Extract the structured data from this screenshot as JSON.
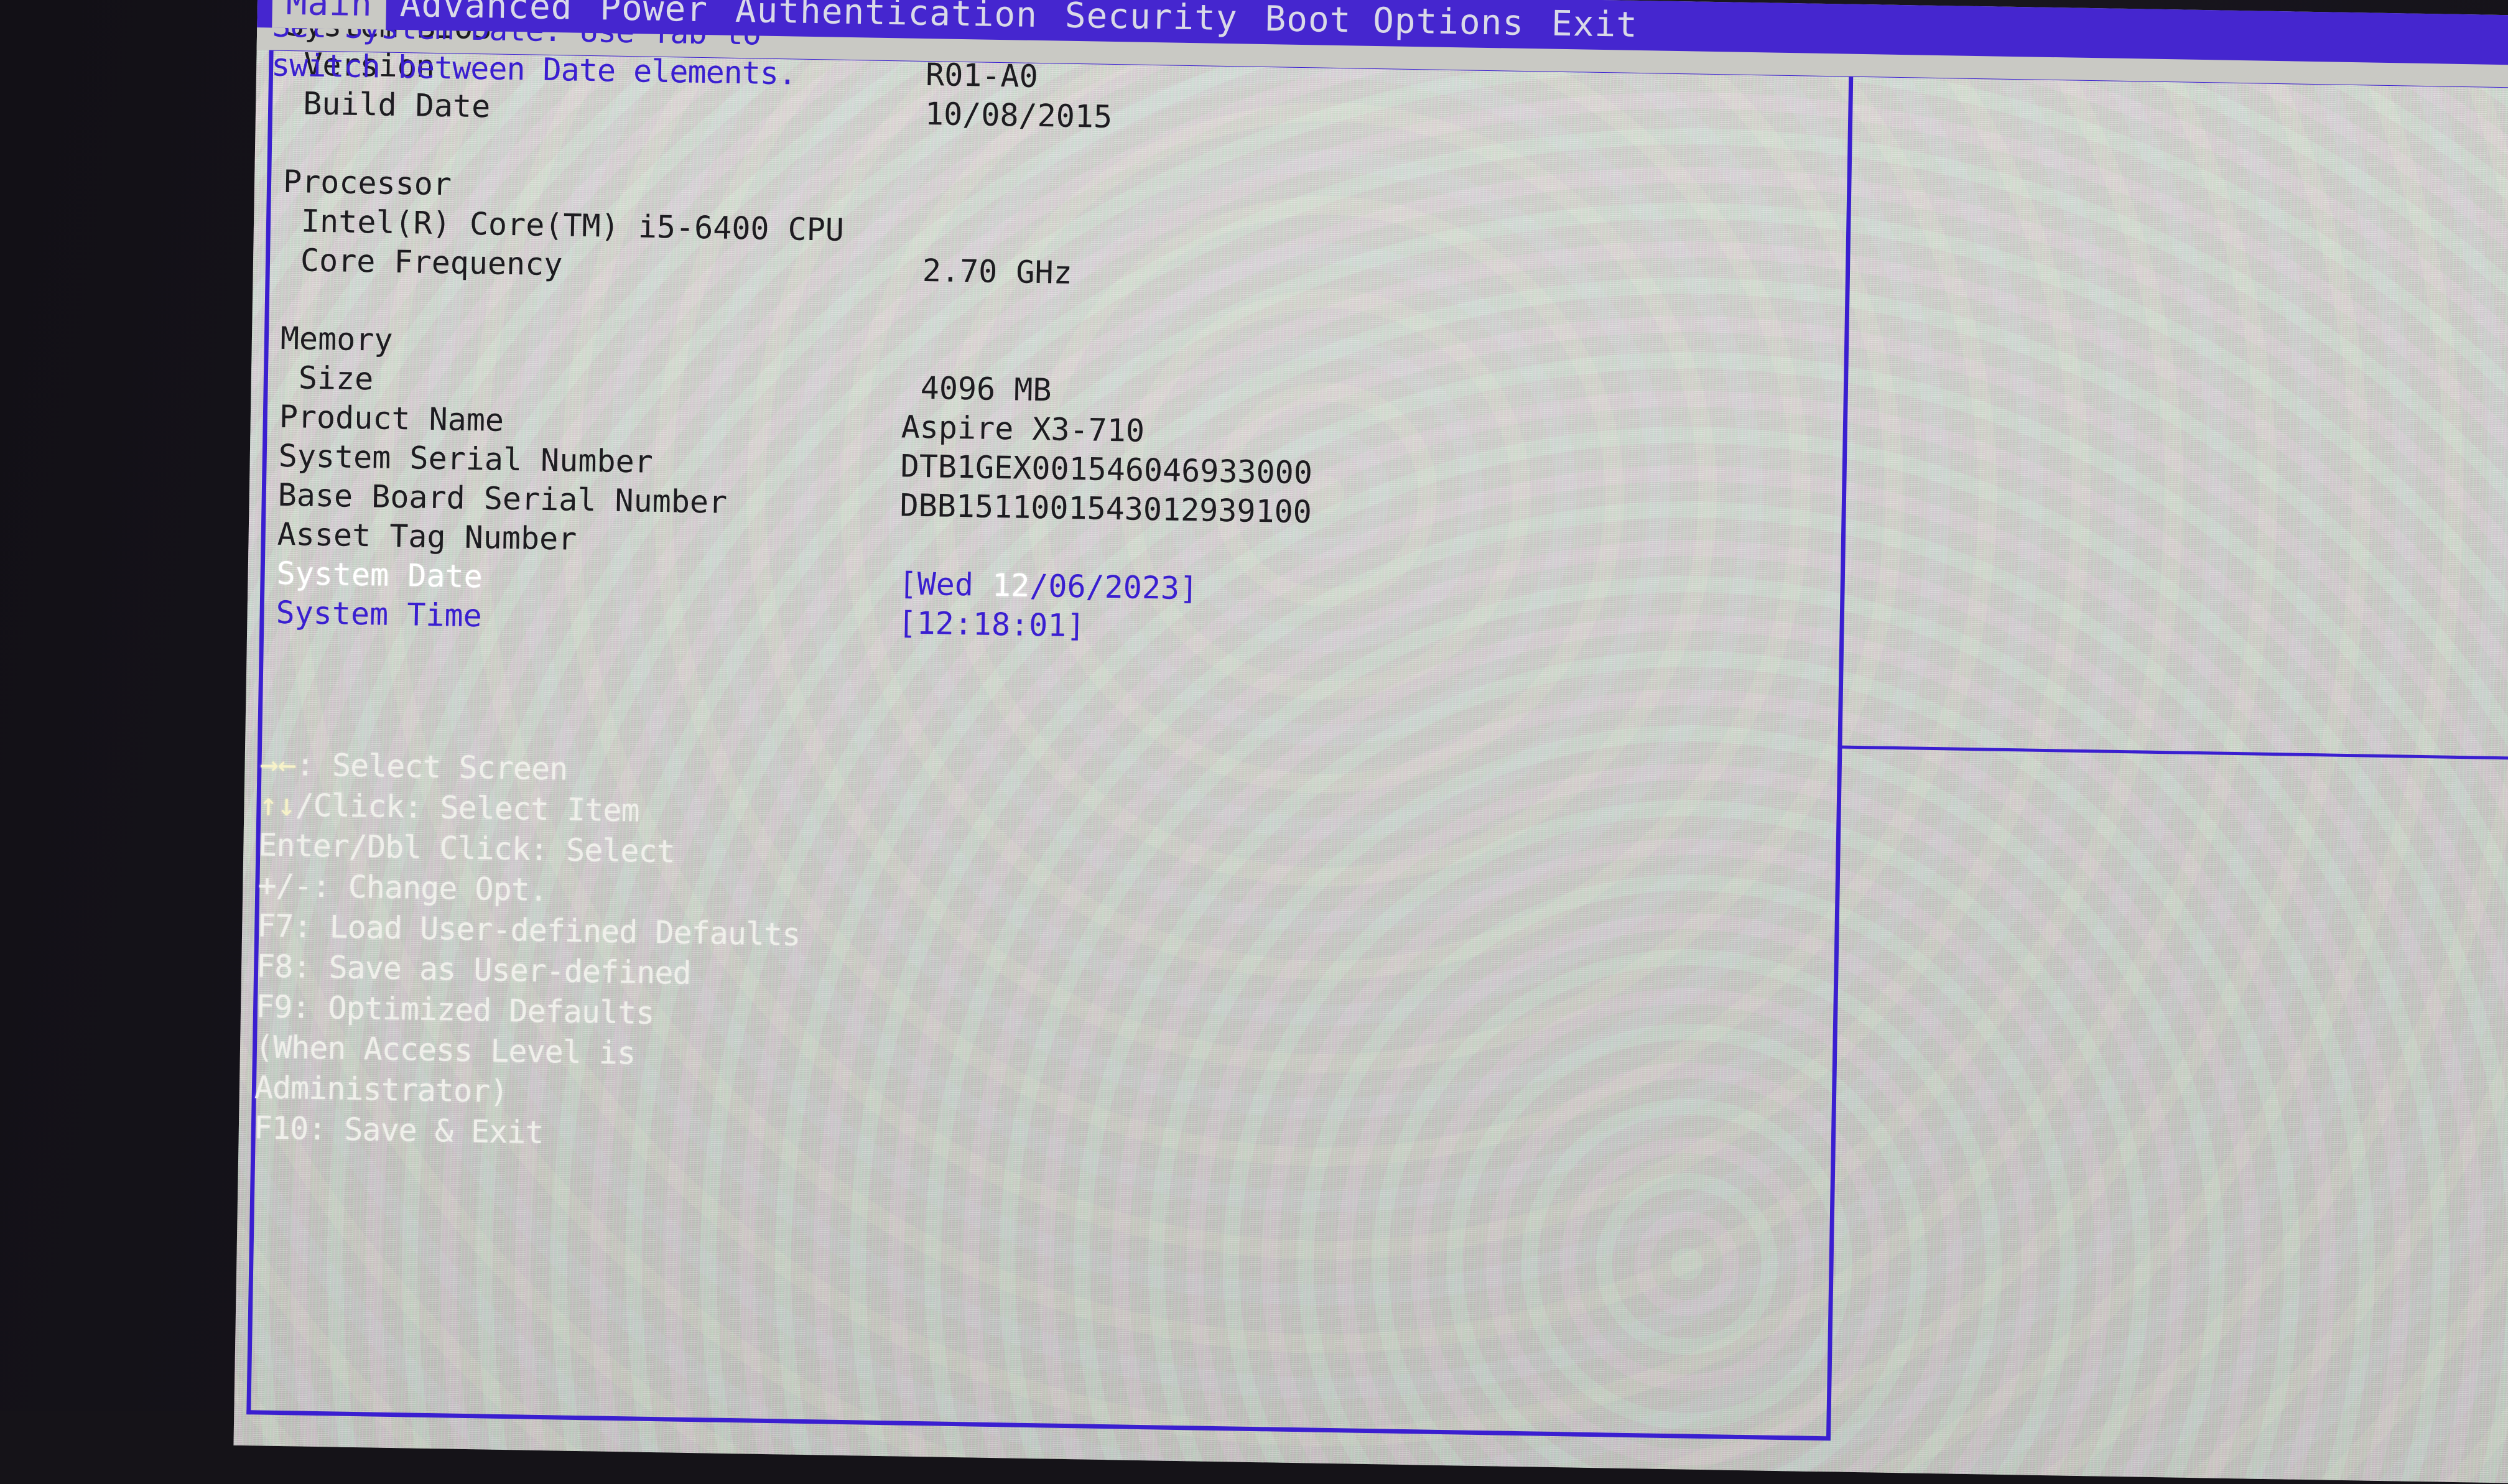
{
  "menubar": {
    "tabs": [
      {
        "label": "Main",
        "active": true
      },
      {
        "label": "Advanced",
        "active": false
      },
      {
        "label": "Power",
        "active": false
      },
      {
        "label": "Authentication",
        "active": false
      },
      {
        "label": "Security",
        "active": false
      },
      {
        "label": "Boot Options",
        "active": false
      },
      {
        "label": "Exit",
        "active": false
      }
    ]
  },
  "main": {
    "rows": [
      {
        "label": "System BIOS",
        "value": "",
        "indent": false,
        "state": "normal"
      },
      {
        "label": "Version",
        "value": "R01-A0",
        "indent": true,
        "state": "normal"
      },
      {
        "label": "Build Date",
        "value": "10/08/2015",
        "indent": true,
        "state": "normal"
      },
      {
        "label": "Processor",
        "value": "",
        "indent": false,
        "state": "normal"
      },
      {
        "label": "Intel(R) Core(TM) i5-6400 CPU",
        "value": "",
        "indent": true,
        "state": "normal"
      },
      {
        "label": "Core Frequency",
        "value": "2.70 GHz",
        "indent": true,
        "state": "normal"
      },
      {
        "label": "Memory",
        "value": "",
        "indent": false,
        "state": "normal"
      },
      {
        "label": "Size",
        "value": "4096 MB",
        "indent": true,
        "state": "normal"
      },
      {
        "label": "Product Name",
        "value": "Aspire X3-710",
        "indent": false,
        "state": "normal"
      },
      {
        "label": "System Serial Number",
        "value": "DTB1GEX001546046933000",
        "indent": false,
        "state": "normal"
      },
      {
        "label": "Base Board Serial Number",
        "value": "DBB1511001543012939100",
        "indent": false,
        "state": "normal"
      },
      {
        "label": "Asset Tag Number",
        "value": "",
        "indent": false,
        "state": "normal"
      }
    ],
    "system_date": {
      "label": "System Date",
      "value_open": "[",
      "value_weekday": "Wed ",
      "value_month": "12",
      "value_rest": "/06/2023",
      "value_close": "]",
      "full_value": "[Wed 12/06/2023]"
    },
    "system_time": {
      "label": "System Time",
      "full_value": "[12:18:01]"
    }
  },
  "help": {
    "lines": [
      "Set System Date. Use Tab to",
      "switch between Date elements."
    ]
  },
  "legend": {
    "items": [
      {
        "keys": "→←",
        "text": ": Select Screen"
      },
      {
        "keys": "↑↓",
        "text": "/Click: Select Item"
      },
      {
        "keys": "",
        "text": "Enter/Dbl Click: Select"
      },
      {
        "keys": "",
        "text": "+/-: Change Opt."
      },
      {
        "keys": "",
        "text": "F7: Load User-defined Defaults"
      },
      {
        "keys": "",
        "text": "F8: Save as User-defined"
      },
      {
        "keys": "",
        "text": "F9: Optimized Defaults"
      },
      {
        "keys": "",
        "text": "(When Access Level is"
      },
      {
        "keys": "",
        "text": "Administrator)"
      },
      {
        "keys": "",
        "text": "F10: Save & Exit"
      }
    ]
  },
  "colors": {
    "menubar_blue": "#4526cf",
    "border_blue": "#3a1fd0",
    "lcd_gray": "#c9c9c4",
    "text_black": "#1d1c20",
    "text_white": "#ffffff",
    "legend_text": "#efefea",
    "arrow_yellow": "#f7f2c8"
  }
}
